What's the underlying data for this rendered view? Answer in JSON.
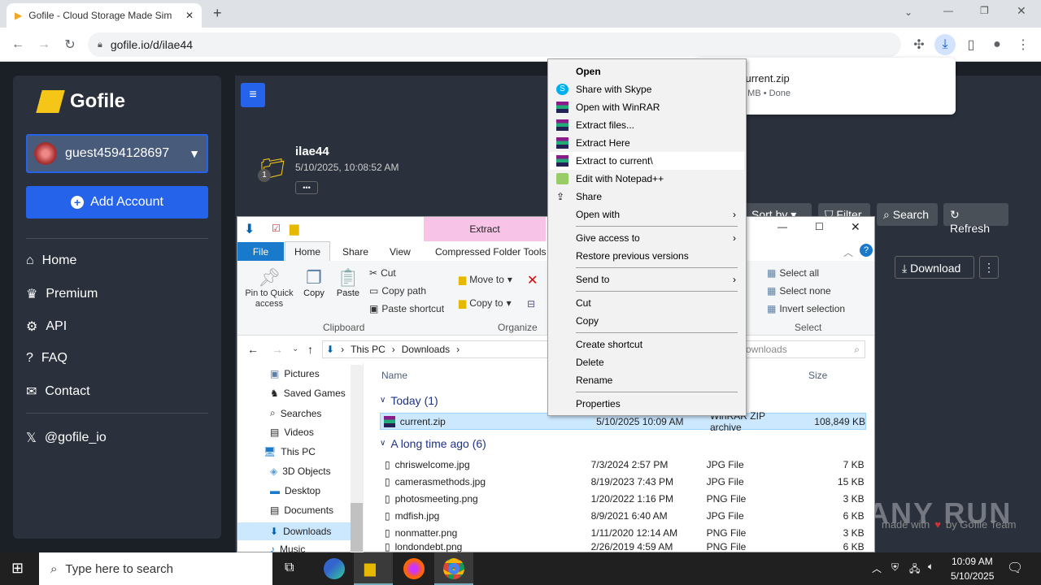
{
  "browser": {
    "tab_title": "Gofile - Cloud Storage Made Sim",
    "url": "gofile.io/d/ilae44",
    "download": {
      "filename": "current.zip",
      "status": "6 MB • Done"
    }
  },
  "sidebar": {
    "brand": "Gofile",
    "account": "guest4594128697",
    "add_account": "Add Account",
    "nav": [
      "Home",
      "Premium",
      "API",
      "FAQ",
      "Contact"
    ],
    "social": "@gofile_io"
  },
  "folder": {
    "name": "ilae44",
    "date": "5/10/2025, 10:08:52 AM",
    "count": "1",
    "more": "•••",
    "sort": "Sort by",
    "filter": "Filter",
    "search": "Search",
    "refresh": "Refresh",
    "download": "Download"
  },
  "explorer": {
    "extract_tab": "Extract",
    "tabs": [
      "File",
      "Home",
      "Share",
      "View",
      "Compressed Folder Tools"
    ],
    "clipboard": {
      "pin": "Pin to Quick access",
      "copy": "Copy",
      "paste": "Paste",
      "cut": "Cut",
      "copy_path": "Copy path",
      "paste_shortcut": "Paste shortcut",
      "group": "Clipboard"
    },
    "organize": {
      "move_to": "Move to",
      "copy_to": "Copy to",
      "group": "Organize"
    },
    "select": {
      "all": "Select all",
      "none": "Select none",
      "invert": "Invert selection",
      "group": "Select"
    },
    "breadcrumb": [
      "This PC",
      "Downloads"
    ],
    "search_placeholder": "ownloads",
    "columns": {
      "name": "Name",
      "size": "Size"
    },
    "tree": [
      "Pictures",
      "Saved Games",
      "Searches",
      "Videos",
      "This PC",
      "3D Objects",
      "Desktop",
      "Documents",
      "Downloads",
      "Music"
    ],
    "groups": {
      "today": "Today (1)",
      "older": "A long time ago (6)"
    },
    "files": [
      {
        "name": "current.zip",
        "date": "5/10/2025 10:09 AM",
        "type": "WinRAR ZIP archive",
        "size": "108,849 KB"
      },
      {
        "name": "chriswelcome.jpg",
        "date": "7/3/2024 2:57 PM",
        "type": "JPG File",
        "size": "7 KB"
      },
      {
        "name": "camerasmethods.jpg",
        "date": "8/19/2023 7:43 PM",
        "type": "JPG File",
        "size": "15 KB"
      },
      {
        "name": "photosmeeting.png",
        "date": "1/20/2022 1:16 PM",
        "type": "PNG File",
        "size": "3 KB"
      },
      {
        "name": "mdfish.jpg",
        "date": "8/9/2021 6:40 AM",
        "type": "JPG File",
        "size": "6 KB"
      },
      {
        "name": "nonmatter.png",
        "date": "1/11/2020 12:14 AM",
        "type": "PNG File",
        "size": "3 KB"
      },
      {
        "name": "londondebt.png",
        "date": "2/26/2019 4:59 AM",
        "type": "PNG File",
        "size": "6 KB"
      }
    ]
  },
  "context_menu": [
    "Open",
    "Share with Skype",
    "Open with WinRAR",
    "Extract files...",
    "Extract Here",
    "Extract to current\\",
    "Edit with Notepad++",
    "Share",
    "Open with",
    "Give access to",
    "Restore previous versions",
    "Send to",
    "Cut",
    "Copy",
    "Create shortcut",
    "Delete",
    "Rename",
    "Properties"
  ],
  "watermark": {
    "text": "ANY RUN",
    "made": "made with",
    "by": "by Gofile Team"
  },
  "taskbar": {
    "search_placeholder": "Type here to search",
    "time": "10:09 AM",
    "date": "5/10/2025"
  },
  "colors": {
    "accent": "#2563eb",
    "explorer_blue": "#0063b1",
    "highlight": "#cce8ff"
  }
}
